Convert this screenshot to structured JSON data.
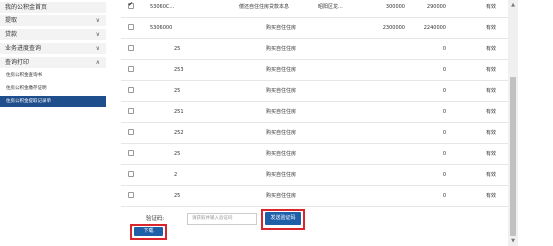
{
  "sidebar": {
    "items": [
      {
        "label": "我的公积金首页",
        "chevron": ""
      },
      {
        "label": "提取",
        "chevron": "∨"
      },
      {
        "label": "贷款",
        "chevron": "∨"
      },
      {
        "label": "业务进度查询",
        "chevron": "∨"
      },
      {
        "label": "查询打印",
        "chevron": "∧"
      }
    ],
    "subitems": [
      {
        "label": "住房公积金查询书",
        "active": false
      },
      {
        "label": "住房公积金缴存证明",
        "active": false
      },
      {
        "label": "住房公积金提取记录单",
        "active": true
      }
    ]
  },
  "table": {
    "rows": [
      {
        "checked": true,
        "id": "53060C...",
        "type": "偿还自住住房贷款本息",
        "loc": "昭阳区龙...",
        "a1": "300000",
        "a2": "290000",
        "status": "有效"
      },
      {
        "checked": false,
        "id": "5306000",
        "type": "购买自住住房",
        "loc": "",
        "a1": "2300000",
        "a2": "2240000",
        "status": "有效"
      },
      {
        "checked": false,
        "id": "25",
        "type": "购买自住住房",
        "loc": "",
        "a1": "",
        "a2": "0",
        "status": "有效"
      },
      {
        "checked": false,
        "id": "253",
        "type": "购买自住住房",
        "loc": "",
        "a1": "",
        "a2": "0",
        "status": "有效"
      },
      {
        "checked": false,
        "id": "25",
        "type": "购买自住住房",
        "loc": "",
        "a1": "",
        "a2": "0",
        "status": "有效"
      },
      {
        "checked": false,
        "id": "251",
        "type": "购买自住住房",
        "loc": "",
        "a1": "",
        "a2": "0",
        "status": "有效"
      },
      {
        "checked": false,
        "id": "252",
        "type": "购买自住住房",
        "loc": "",
        "a1": "",
        "a2": "0",
        "status": "有效"
      },
      {
        "checked": false,
        "id": "25",
        "type": "购买自住住房",
        "loc": "",
        "a1": "",
        "a2": "0",
        "status": "有效"
      },
      {
        "checked": false,
        "id": "2",
        "type": "购买自住住房",
        "loc": "",
        "a1": "",
        "a2": "0",
        "status": "有效"
      },
      {
        "checked": false,
        "id": "25",
        "type": "购买自住住房",
        "loc": "",
        "a1": "",
        "a2": "0",
        "status": "有效"
      }
    ]
  },
  "form": {
    "code_label": "验证码:",
    "code_placeholder": "请获取并输入验证码",
    "send_button": "发送验证码",
    "download_button": "下载"
  },
  "scrollbar": {
    "up_icon": "▲",
    "down_icon": "▼"
  }
}
